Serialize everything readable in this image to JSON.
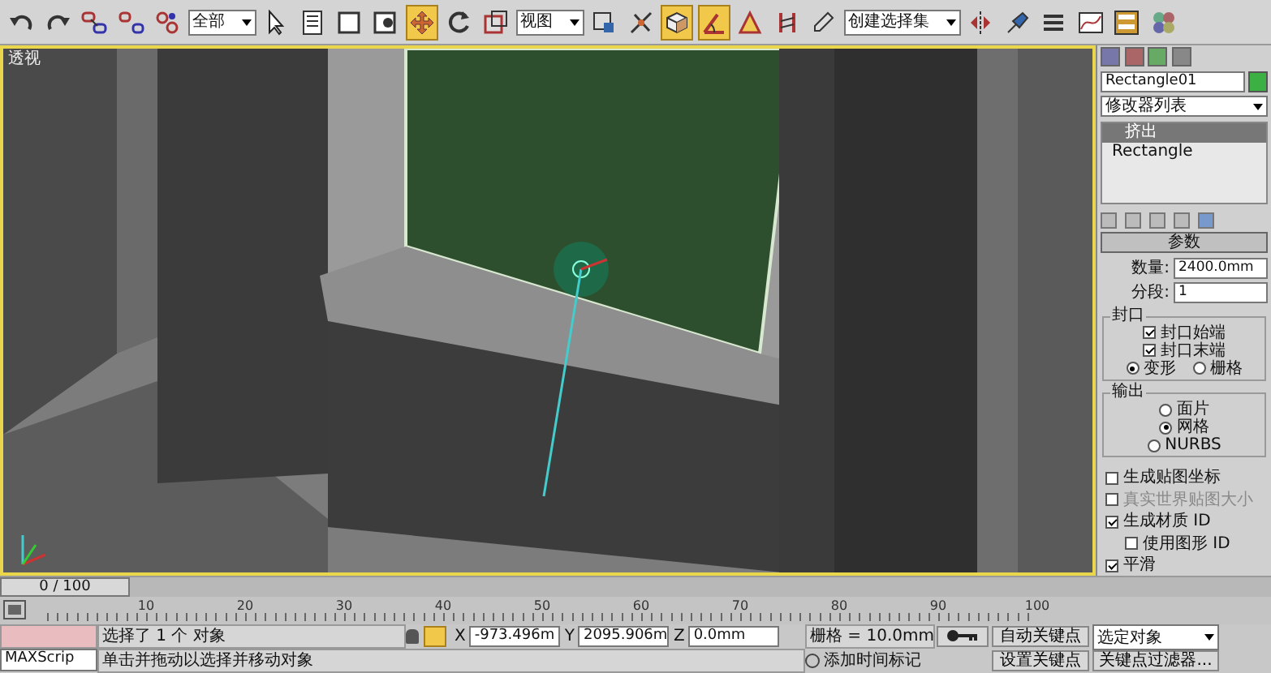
{
  "toolbar": {
    "items": [
      {
        "kind": "tool",
        "active": false
      },
      {
        "kind": "tool",
        "active": false
      },
      {
        "kind": "tool",
        "active": false
      },
      {
        "kind": "tool",
        "active": false
      },
      {
        "kind": "tool",
        "active": false
      },
      {
        "kind": "dropdown",
        "value": "全部"
      },
      {
        "kind": "tool",
        "active": false
      },
      {
        "kind": "tool",
        "active": false
      },
      {
        "kind": "tool",
        "active": false
      },
      {
        "kind": "tool",
        "active": false
      },
      {
        "kind": "tool",
        "active": true
      },
      {
        "kind": "tool",
        "active": false
      },
      {
        "kind": "tool",
        "active": false
      },
      {
        "kind": "dropdown",
        "value": "视图"
      },
      {
        "kind": "tool",
        "active": false
      },
      {
        "kind": "tool",
        "active": false
      },
      {
        "kind": "tool",
        "active": true
      },
      {
        "kind": "tool",
        "active": true
      },
      {
        "kind": "tool",
        "active": false
      },
      {
        "kind": "tool",
        "active": false
      },
      {
        "kind": "tool",
        "active": false
      },
      {
        "kind": "dropdown",
        "value": "创建选择集"
      },
      {
        "kind": "tool",
        "active": false
      },
      {
        "kind": "tool",
        "active": false
      },
      {
        "kind": "tool",
        "active": false
      },
      {
        "kind": "tool",
        "active": false
      },
      {
        "kind": "tool",
        "active": false
      },
      {
        "kind": "tool",
        "active": false
      }
    ]
  },
  "viewport": {
    "label": "透视"
  },
  "command_panel": {
    "object_name": "Rectangle01",
    "modifier_list": "修改器列表",
    "stack": [
      {
        "label": "挤出",
        "selected": true
      },
      {
        "label": "Rectangle",
        "selected": false
      }
    ],
    "parameters": {
      "title": "参数",
      "fields": [
        {
          "label": "数量:",
          "value": "2400.0mm"
        },
        {
          "label": "分段:",
          "value": "1"
        }
      ],
      "groups": [
        {
          "title": "封口",
          "rows": [
            [
              {
                "kind": "checkbox",
                "label": "封口始端",
                "checked": true
              }
            ],
            [
              {
                "kind": "checkbox",
                "label": "封口末端",
                "checked": true
              }
            ],
            [
              {
                "kind": "radio",
                "label": "变形",
                "selected": true
              },
              {
                "kind": "radio",
                "label": "栅格",
                "selected": false
              }
            ]
          ]
        },
        {
          "title": "输出",
          "rows": [
            [
              {
                "kind": "radio",
                "label": "面片",
                "selected": false
              }
            ],
            [
              {
                "kind": "radio",
                "label": "网格",
                "selected": true
              }
            ],
            [
              {
                "kind": "radio",
                "label": "NURBS",
                "selected": false
              }
            ]
          ]
        }
      ],
      "options": [
        {
          "label": "生成贴图坐标",
          "checked": false,
          "disabled": false
        },
        {
          "label": "真实世界贴图大小",
          "checked": false,
          "disabled": true
        },
        {
          "label": "生成材质 ID",
          "checked": true,
          "disabled": false,
          "children": [
            {
              "label": "使用图形 ID",
              "checked": false,
              "disabled": false
            }
          ]
        },
        {
          "label": "平滑",
          "checked": true,
          "disabled": false
        }
      ]
    }
  },
  "time_slider": {
    "text": "0 / 100",
    "level": 0
  },
  "track_bar": {
    "ticks": [
      "10",
      "20",
      "30",
      "40",
      "50",
      "60",
      "70",
      "80",
      "90",
      "100"
    ]
  },
  "status": {
    "selection": "选择了 1 个 对象",
    "coordinates": [
      {
        "axis": "X",
        "value": "-973.496m"
      },
      {
        "axis": "Y",
        "value": "2095.906m"
      },
      {
        "axis": "Z",
        "value": "0.0mm"
      }
    ],
    "grid": "栅格 = 10.0mm",
    "auto_key": "自动关键点",
    "key_mode": "选定对象",
    "set_key": "设置关键点",
    "key_filters": "关键点过滤器...",
    "script": "MAXScrip",
    "prompt": "单击并拖动以选择并移动对象",
    "time_tag": "添加时间标记"
  }
}
